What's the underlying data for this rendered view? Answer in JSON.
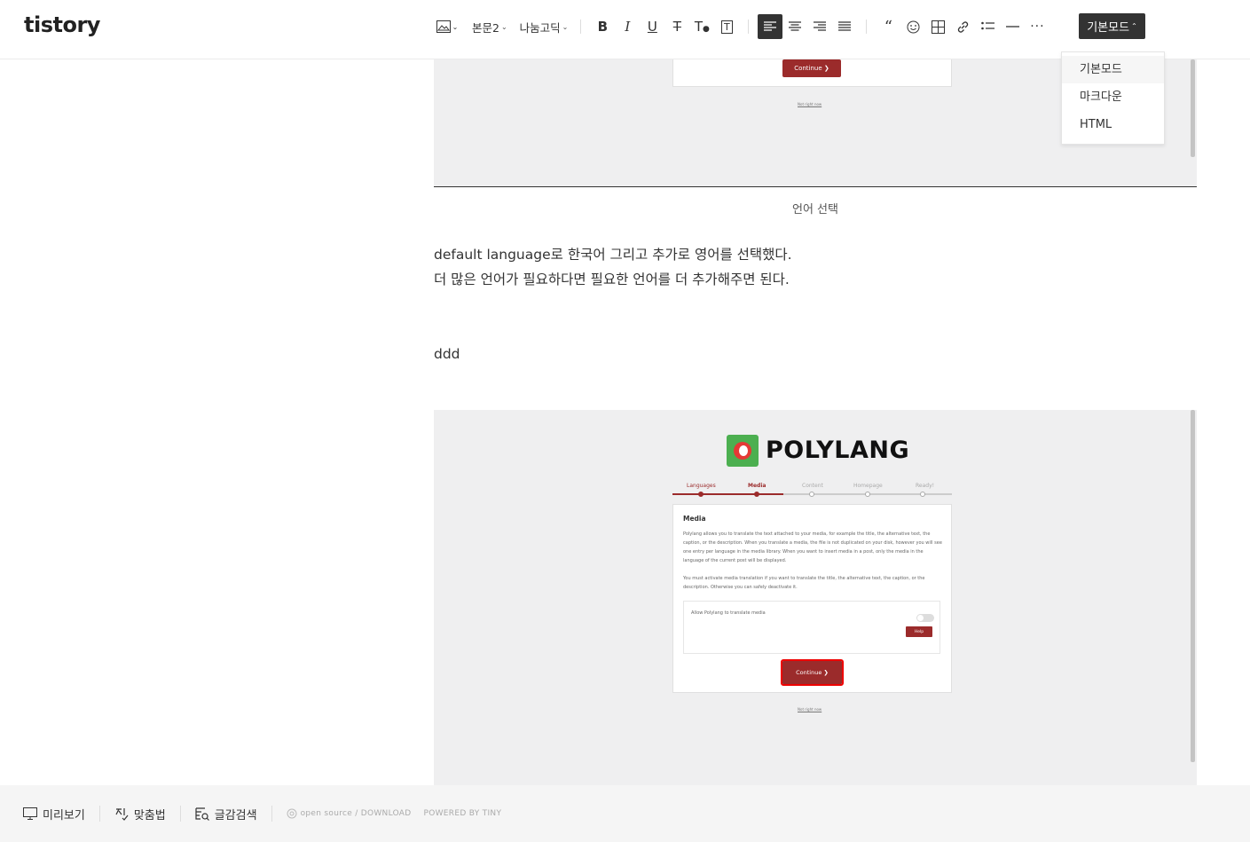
{
  "header": {
    "logo": "tistory",
    "toolbar": {
      "paragraph_style": "본문2",
      "font": "나눔고딕",
      "mode_label": "기본모드"
    }
  },
  "mode_dropdown": {
    "items": [
      {
        "label": "기본모드",
        "selected": true
      },
      {
        "label": "마크다운",
        "selected": false
      },
      {
        "label": "HTML",
        "selected": false
      }
    ]
  },
  "content": {
    "top_image": {
      "button": "Continue ❯",
      "skip": "Not right now"
    },
    "caption": "언어 선택",
    "paragraphs": [
      "default language로 한국어 그리고 추가로 영어를 선택했다.",
      "더 많은 언어가 필요하다면 필요한 언어를 더 추가해주면 된다.",
      "ddd"
    ],
    "bottom_image": {
      "title": "POLYLANG",
      "steps": [
        {
          "label": "Languages",
          "state": "done"
        },
        {
          "label": "Media",
          "state": "current"
        },
        {
          "label": "Content",
          "state": "todo"
        },
        {
          "label": "Homepage",
          "state": "todo"
        },
        {
          "label": "Ready!",
          "state": "todo"
        }
      ],
      "card_heading": "Media",
      "card_text_1": "Polylang allows you to translate the text attached to your media, for example the title, the alternative text, the caption, or the description. When you translate a media, the file is not duplicated on your disk, however you will see one entry per language in the media library. When you want to insert media in a post, only the media in the language of the current post will be displayed.",
      "card_text_2": "You must activate media translation if you want to translate the title, the alternative text, the caption, or the description. Otherwise you can safely deactivate it.",
      "option_label": "Allow Polylang to translate media",
      "help_label": "Help",
      "button": "Continue ❯",
      "skip": "Not right now"
    }
  },
  "footer": {
    "preview": "미리보기",
    "spellcheck": "맞춤법",
    "search": "글감검색",
    "open_source": "open source / DOWNLOAD",
    "powered": "POWERED BY TINY"
  },
  "colors": {
    "dark": "#333333",
    "brand_red": "#9b2b2b",
    "highlight": "#ee0000"
  }
}
